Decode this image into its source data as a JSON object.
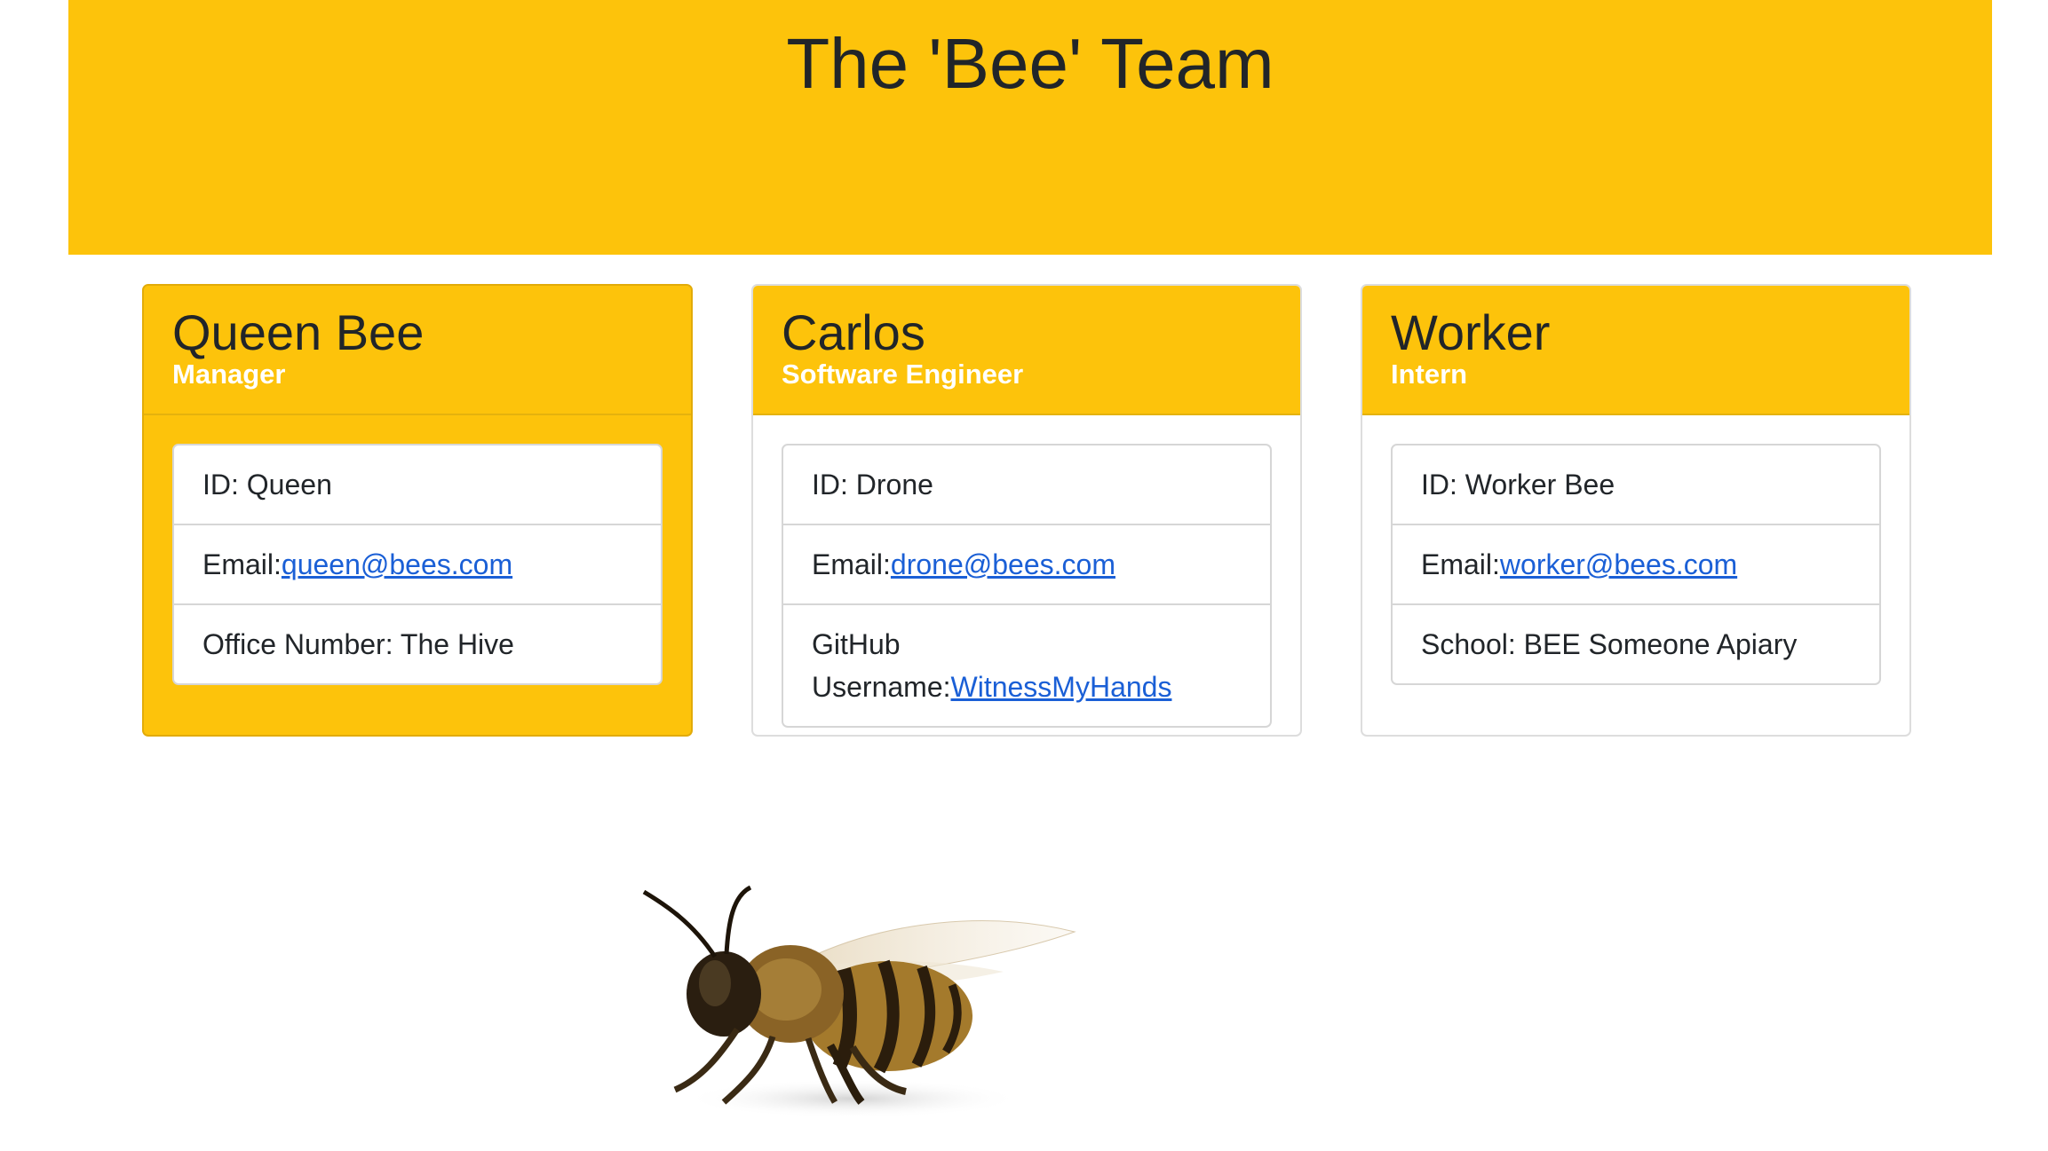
{
  "header": {
    "title": "The 'Bee' Team"
  },
  "colors": {
    "accent": "#fdc30b",
    "link": "#1a5fd6",
    "role_text": "#ffffff",
    "text": "#212529"
  },
  "cards": [
    {
      "name": "Queen Bee",
      "role": "Manager",
      "id_line": "ID: Queen",
      "email_label": "Email:",
      "email": "queen@bees.com",
      "extra_label": "Office Number: The Hive"
    },
    {
      "name": "Carlos",
      "role": "Software Engineer",
      "id_line": "ID: Drone",
      "email_label": "Email:",
      "email": "drone@bees.com",
      "extra_label": "GitHub Username:",
      "extra_link": "WitnessMyHands"
    },
    {
      "name": "Worker",
      "role": "Intern",
      "id_line": "ID: Worker Bee",
      "email_label": "Email:",
      "email": "worker@bees.com",
      "extra_label": "School: BEE Someone Apiary"
    }
  ],
  "image": {
    "icon": "honeybee-image"
  }
}
